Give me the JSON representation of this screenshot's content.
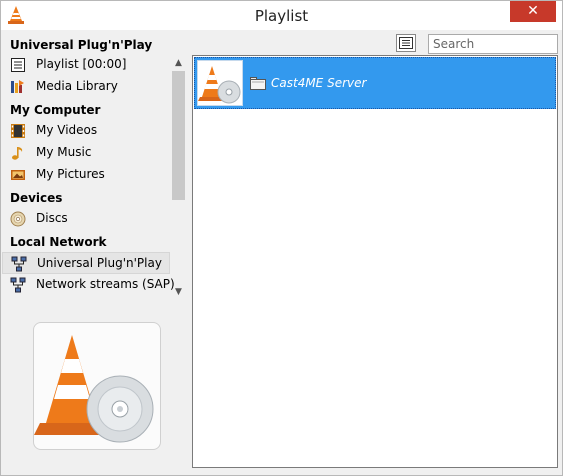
{
  "window": {
    "title": "Playlist",
    "close_glyph": "✕"
  },
  "toolbar": {
    "search_placeholder": "Search",
    "view_icon": "list-view-icon"
  },
  "sidebar": {
    "top_header": "Universal Plug'n'Play",
    "playlist_label": "Playlist [00:00]",
    "media_library_label": "Media Library",
    "my_computer_header": "My Computer",
    "my_videos_label": "My Videos",
    "my_music_label": "My Music",
    "my_pictures_label": "My Pictures",
    "devices_header": "Devices",
    "discs_label": "Discs",
    "local_network_header": "Local Network",
    "upnp_label": "Universal Plug'n'Play",
    "sap_label": "Network streams (SAP)"
  },
  "playlist": {
    "items": [
      {
        "name": "Cast4ME Server",
        "icon": "folder-icon"
      }
    ]
  },
  "colors": {
    "selection": "#3399ee",
    "close": "#c7392a",
    "cone_orange": "#ee7a1a"
  }
}
